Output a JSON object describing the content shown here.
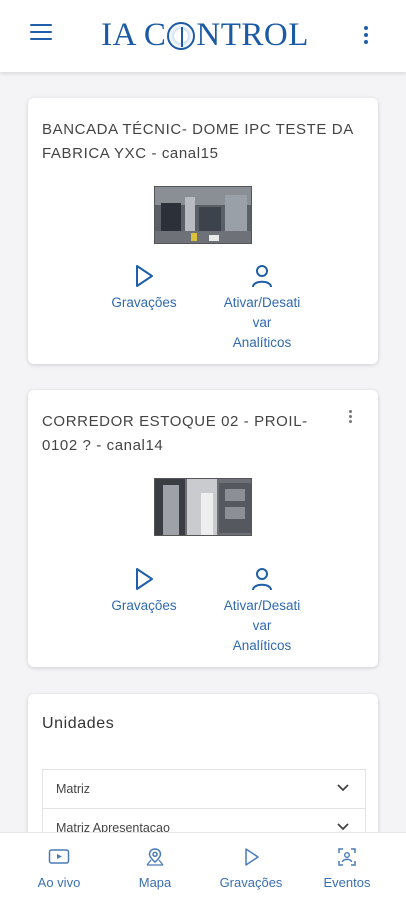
{
  "header": {
    "brand": "IA CONTROL",
    "menu_icon": "hamburger-menu-icon",
    "more_icon": "more-vert-icon"
  },
  "cameras": [
    {
      "title": "BANCADA TÉCNIC- DOME IPC TESTE DA FABRICA YXC - canal15",
      "actions": {
        "recordings": "Gravações",
        "analytics_line1": "Ativar/Desati",
        "analytics_line2": "var",
        "analytics_line3": "Analíticos"
      }
    },
    {
      "title": "CORREDOR ESTOQUE 02 - PROIL-0102 ? - canal14",
      "actions": {
        "recordings": "Gravações",
        "analytics_line1": "Ativar/Desati",
        "analytics_line2": "var",
        "analytics_line3": "Analíticos"
      }
    }
  ],
  "units": {
    "title": "Unidades",
    "items": [
      "Matriz",
      "Matriz Apresentacao"
    ]
  },
  "bottom_nav": [
    {
      "label": "Ao vivo",
      "icon": "live-tv-icon"
    },
    {
      "label": "Mapa",
      "icon": "map-icon"
    },
    {
      "label": "Gravações",
      "icon": "play-icon"
    },
    {
      "label": "Eventos",
      "icon": "events-scan-icon"
    }
  ],
  "colors": {
    "accent": "#1f5fa9",
    "link": "#2f6ab0",
    "background": "#f4f4f6"
  }
}
